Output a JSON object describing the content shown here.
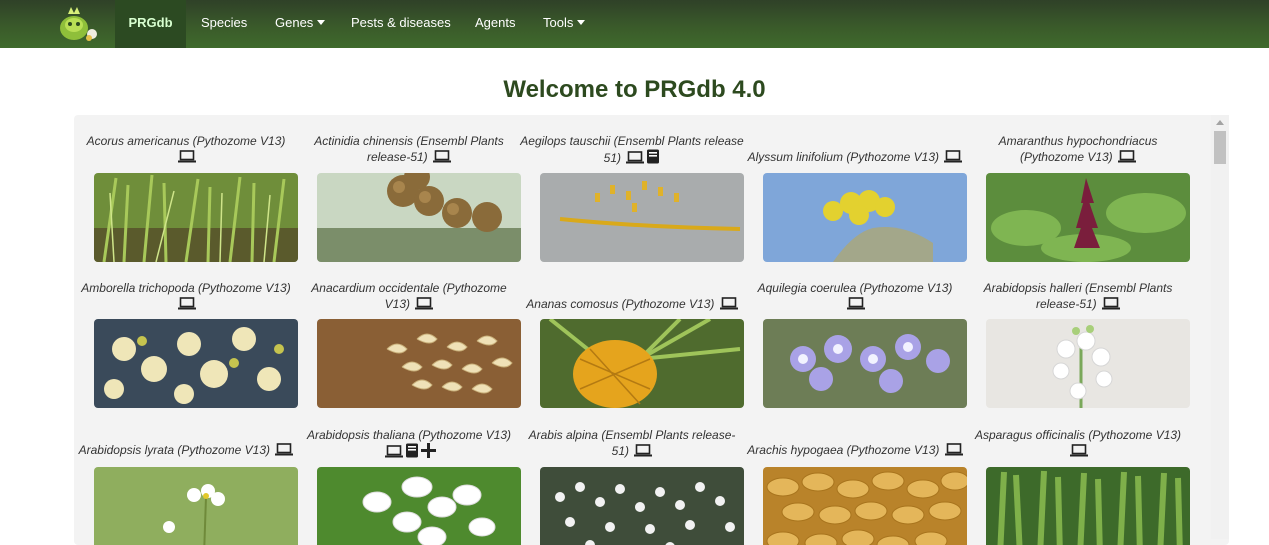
{
  "nav": {
    "brand": "PRGdb",
    "items": [
      {
        "label": "Species"
      },
      {
        "label": "Genes"
      },
      {
        "label": "Pests & diseases"
      },
      {
        "label": "Agents"
      },
      {
        "label": "Tools"
      }
    ]
  },
  "page_title": "Welcome to PRGdb 4.0",
  "species": [
    {
      "name": "Acorus americanus (Pythozome V13)",
      "icons": [
        "laptop-icon"
      ]
    },
    {
      "name": "Actinidia chinensis (Ensembl Plants release-51)",
      "icons": [
        "laptop-icon"
      ]
    },
    {
      "name": "Aegilops tauschii (Ensembl Plants release 51)",
      "icons": [
        "laptop-icon",
        "book-icon"
      ]
    },
    {
      "name": "Alyssum linifolium (Pythozome V13)",
      "icons": [
        "laptop-icon"
      ]
    },
    {
      "name": "Amaranthus hypochondriacus (Pythozome V13)",
      "icons": [
        "laptop-icon"
      ]
    },
    {
      "name": "Amborella trichopoda (Pythozome V13)",
      "icons": [
        "laptop-icon"
      ]
    },
    {
      "name": "Anacardium occidentale (Pythozome V13)",
      "icons": [
        "laptop-icon"
      ]
    },
    {
      "name": "Ananas comosus (Pythozome V13)",
      "icons": [
        "laptop-icon"
      ]
    },
    {
      "name": "Aquilegia coerulea (Pythozome V13)",
      "icons": [
        "laptop-icon"
      ]
    },
    {
      "name": "Arabidopsis halleri (Ensembl Plants release-51)",
      "icons": [
        "laptop-icon"
      ]
    },
    {
      "name": "Arabidopsis lyrata (Pythozome V13)",
      "icons": [
        "laptop-icon"
      ]
    },
    {
      "name": "Arabidopsis thaliana (Pythozome V13)",
      "icons": [
        "laptop-icon",
        "book-icon",
        "plus-icon"
      ]
    },
    {
      "name": "Arabis alpina (Ensembl Plants release-51)",
      "icons": [
        "laptop-icon"
      ]
    },
    {
      "name": "Arachis hypogaea (Pythozome V13)",
      "icons": [
        "laptop-icon"
      ]
    },
    {
      "name": "Asparagus officinalis (Pythozome V13)",
      "icons": [
        "laptop-icon"
      ]
    }
  ]
}
